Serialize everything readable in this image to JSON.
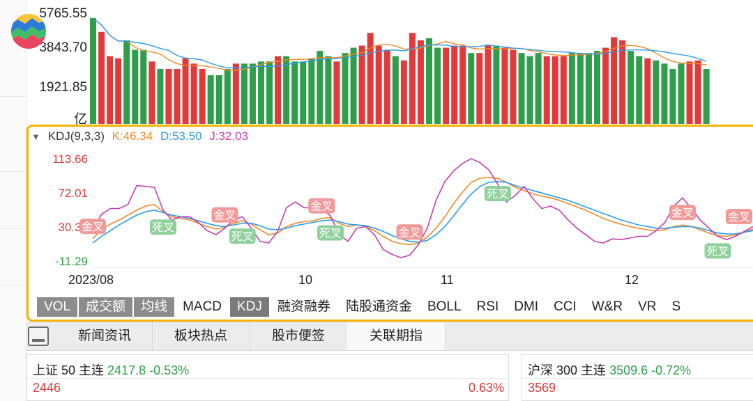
{
  "volume": {
    "axis_labels": [
      "5765.55",
      "3843.70",
      "1921.85",
      "亿"
    ],
    "bars_relative": [
      1.0,
      0.87,
      0.64,
      0.62,
      0.79,
      0.7,
      0.7,
      0.59,
      0.52,
      0.52,
      0.52,
      0.62,
      0.57,
      0.52,
      0.46,
      0.46,
      0.52,
      0.57,
      0.57,
      0.57,
      0.59,
      0.59,
      0.64,
      0.64,
      0.59,
      0.59,
      0.62,
      0.69,
      0.64,
      0.59,
      0.67,
      0.72,
      0.74,
      0.86,
      0.74,
      0.7,
      0.64,
      0.6,
      0.86,
      0.79,
      0.81,
      0.72,
      0.72,
      0.74,
      0.74,
      0.67,
      0.67,
      0.74,
      0.74,
      0.72,
      0.7,
      0.67,
      0.64,
      0.67,
      0.64,
      0.64,
      0.64,
      0.67,
      0.67,
      0.67,
      0.69,
      0.72,
      0.82,
      0.79,
      0.69,
      0.64,
      0.62,
      0.6,
      0.57,
      0.52,
      0.57,
      0.59,
      0.6,
      0.52
    ],
    "bar_colors": [
      "g",
      "r",
      "r",
      "r",
      "g",
      "g",
      "g",
      "r",
      "g",
      "r",
      "r",
      "r",
      "r",
      "r",
      "g",
      "g",
      "g",
      "r",
      "g",
      "g",
      "g",
      "g",
      "r",
      "g",
      "g",
      "g",
      "g",
      "g",
      "g",
      "r",
      "g",
      "g",
      "r",
      "r",
      "r",
      "r",
      "g",
      "r",
      "r",
      "r",
      "g",
      "g",
      "r",
      "r",
      "r",
      "g",
      "r",
      "r",
      "g",
      "r",
      "r",
      "g",
      "g",
      "g",
      "r",
      "r",
      "r",
      "g",
      "g",
      "g",
      "g",
      "r",
      "r",
      "r",
      "g",
      "g",
      "r",
      "g",
      "g",
      "g",
      "g",
      "r",
      "r",
      "g"
    ]
  },
  "kdj": {
    "title": "KDJ(9,3,3)",
    "k_label": "K:46.34",
    "d_label": "D:53.50",
    "j_label": "J:32.03",
    "y_ticks": [
      "113.66",
      "72.01",
      "30.36",
      "-11.29"
    ],
    "x_ticks": [
      "2023/08",
      "10",
      "11",
      "12"
    ],
    "signals": [
      "金叉",
      "死叉",
      "金叉",
      "死叉",
      "金叉",
      "死叉",
      "金叉",
      "死叉",
      "金叉",
      "死叉",
      "金叉"
    ]
  },
  "chart_data": {
    "type": "line",
    "title": "KDJ(9,3,3)",
    "ylim": [
      -11.29,
      113.66
    ],
    "x_ticks": [
      "2023/08",
      "10",
      "11",
      "12"
    ],
    "series": [
      {
        "name": "K",
        "color": "#f08a24",
        "values": [
          15,
          26,
          33,
          38,
          44,
          50,
          55,
          57,
          48,
          42,
          40,
          38,
          34,
          30,
          27,
          29,
          34,
          37,
          33,
          26,
          20,
          22,
          30,
          34,
          36,
          37,
          40,
          41,
          34,
          30,
          32,
          30,
          25,
          18,
          12,
          9,
          8,
          10,
          17,
          28,
          42,
          58,
          72,
          84,
          89,
          90,
          89,
          84,
          78,
          74,
          70,
          67,
          65,
          62,
          58,
          54,
          50,
          45,
          40,
          36,
          33,
          30,
          28,
          26,
          25,
          26,
          30,
          32,
          30,
          26,
          22,
          19,
          18,
          20,
          23,
          27
        ]
      },
      {
        "name": "D",
        "color": "#2b9be8",
        "values": [
          10,
          18,
          25,
          32,
          38,
          44,
          48,
          50,
          47,
          44,
          42,
          40,
          37,
          34,
          31,
          30,
          32,
          34,
          34,
          31,
          27,
          26,
          28,
          31,
          33,
          35,
          37,
          38,
          36,
          33,
          32,
          31,
          28,
          24,
          19,
          15,
          12,
          11,
          13,
          20,
          30,
          43,
          57,
          70,
          79,
          84,
          85,
          84,
          80,
          77,
          74,
          71,
          68,
          65,
          62,
          58,
          54,
          50,
          46,
          42,
          38,
          35,
          32,
          30,
          28,
          28,
          29,
          30,
          30,
          28,
          25,
          22,
          21,
          21,
          23,
          25
        ]
      },
      {
        "name": "J",
        "color": "#c43db3",
        "values": [
          25,
          45,
          52,
          52,
          57,
          80,
          79,
          78,
          50,
          38,
          42,
          42,
          35,
          25,
          20,
          28,
          38,
          42,
          28,
          12,
          10,
          24,
          53,
          60,
          53,
          53,
          52,
          43,
          20,
          12,
          28,
          30,
          20,
          2,
          -4,
          -8,
          -5,
          8,
          28,
          62,
          85,
          98,
          107,
          113,
          108,
          99,
          82,
          60,
          68,
          79,
          64,
          52,
          55,
          50,
          38,
          28,
          20,
          12,
          10,
          15,
          14,
          16,
          18,
          18,
          25,
          35,
          55,
          65,
          52,
          38,
          28,
          18,
          14,
          18,
          24,
          30
        ]
      }
    ]
  },
  "tabs": [
    "VOL",
    "成交额",
    "均线",
    "MACD",
    "KDJ",
    "融资融券",
    "陆股通资金",
    "BOLL",
    "RSI",
    "DMI",
    "CCI",
    "W&R",
    "VR",
    "S"
  ],
  "news_tabs": [
    "新闻资讯",
    "板块热点",
    "股市便签",
    "关联期指"
  ],
  "quotes": [
    {
      "name": "上证 50 主连",
      "price": "2417.8",
      "change": "-0.53%",
      "line2_value": "2446",
      "line2_pct": "0.63%"
    },
    {
      "name": "沪深 300 主连",
      "price": "3509.6",
      "change": "-0.72%",
      "line2_value": "3569"
    }
  ],
  "colors": {
    "up": "#e23a3a",
    "down": "#2e9e4a",
    "accent": "#f5b400",
    "k": "#f08a24",
    "d": "#2b9be8",
    "j": "#c43db3"
  }
}
